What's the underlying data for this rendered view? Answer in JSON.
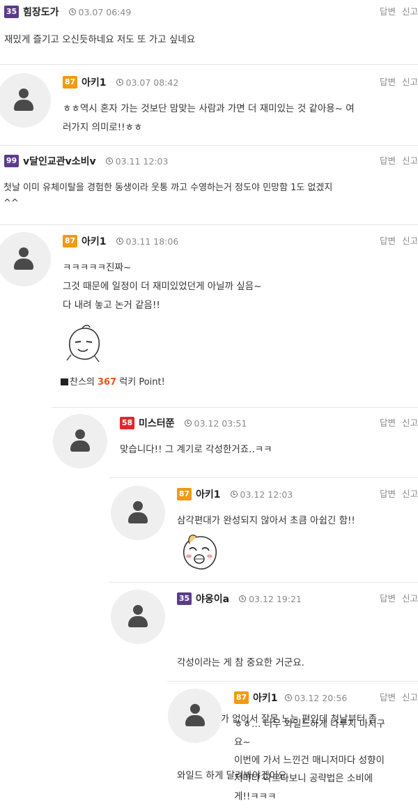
{
  "actions": {
    "reply": "답변",
    "report": "신고"
  },
  "comments": [
    {
      "level": "35",
      "nick": "힘장도가",
      "time": "03.07 06:49",
      "lines": [
        "재밌게 즐기고 오신듯하네요 저도 또 가고 싶네요"
      ]
    },
    {
      "level": "87",
      "nick": "아키1",
      "time": "03.07 08:42",
      "lines": [
        "ㅎㅎ역시 혼자 가는 것보단 맘맞는 사람과 가면 더 재미있는 것 같아용~ 여",
        "러가지 의미로!!ㅎㅎ"
      ]
    },
    {
      "level": "99",
      "nick": "v달인교관v소비v",
      "time": "03.11 12:03",
      "lines": [
        "첫날 이미 유체이탈을 경험한 동생이라 웃통 까고 수영하는거 정도야 민망함 1도 없겠지",
        "^^"
      ]
    },
    {
      "level": "87",
      "nick": "아키1",
      "time": "03.11 18:06",
      "lines": [
        "ㅋㅋㅋㅋㅋ진짜~",
        "그것 때문에 일정이 더 재미있었던게 아닐까 싶음~",
        "다 내려 놓고 논거 같음!!"
      ],
      "point_pre": "찬스의 ",
      "point_num": "367",
      "point_post": " 럭키 Point!"
    },
    {
      "level": "58",
      "nick": "미스터쭌",
      "time": "03.12 03:51",
      "lines": [
        "맞습니다!! 그 계기로 각성한거죠..ㅋㅋ"
      ]
    },
    {
      "level": "87",
      "nick": "아키1",
      "time": "03.12 12:03",
      "lines": [
        "삼각편대가 완성되지 않아서 초큼 아쉽긴 함!!"
      ]
    },
    {
      "level": "35",
      "nick": "야옹이a",
      "time": "03.12 19:21",
      "lines": [
        "각성이라는 게 참 중요한 거군요.",
        "  저도 숫기가 없어서 잘못 노는 편인데 첫날부터 좀",
        "와일드 하게 달려봐야겠어요"
      ]
    },
    {
      "level": "87",
      "nick": "아키1",
      "time": "03.12 20:56",
      "lines": [
        "ㅎㅎ… 너무 와일드하게 다루지 마시구",
        "요~",
        "이번에 가서 느낀건 매니저마다 성향이",
        "저마다 다르다보니 공략법은 소비에",
        "게!!ㅋㅋㅋ"
      ]
    }
  ]
}
